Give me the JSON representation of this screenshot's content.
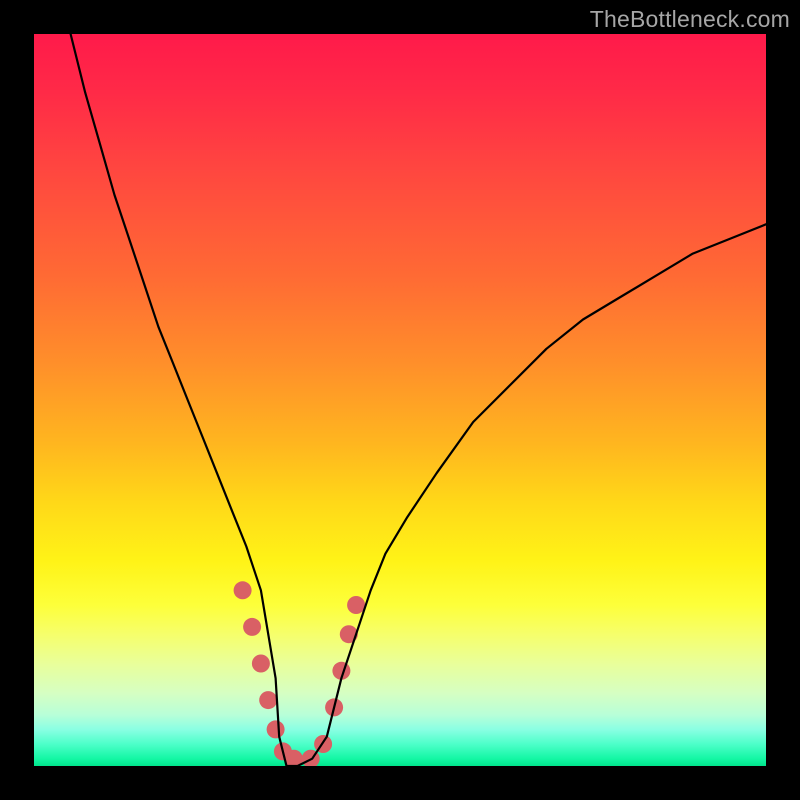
{
  "watermark": "TheBottleneck.com",
  "chart_data": {
    "type": "line",
    "title": "",
    "xlabel": "",
    "ylabel": "",
    "xlim": [
      0,
      100
    ],
    "ylim": [
      0,
      100
    ],
    "series": [
      {
        "name": "bottleneck-curve",
        "x": [
          5,
          7,
          9,
          11,
          13,
          15,
          17,
          19,
          21,
          23,
          25,
          27,
          29,
          31,
          33,
          33.5,
          34.5,
          36,
          38,
          40,
          42,
          44,
          46,
          48,
          51,
          55,
          60,
          65,
          70,
          75,
          80,
          85,
          90,
          95,
          100
        ],
        "values": [
          100,
          92,
          85,
          78,
          72,
          66,
          60,
          55,
          50,
          45,
          40,
          35,
          30,
          24,
          12,
          4,
          0,
          0,
          1,
          4,
          12,
          18,
          24,
          29,
          34,
          40,
          47,
          52,
          57,
          61,
          64,
          67,
          70,
          72,
          74
        ]
      }
    ],
    "marker_region": {
      "name": "optimal-range",
      "points": [
        {
          "x": 28.5,
          "y": 24
        },
        {
          "x": 29.8,
          "y": 19
        },
        {
          "x": 31.0,
          "y": 14
        },
        {
          "x": 32.0,
          "y": 9
        },
        {
          "x": 33.0,
          "y": 5
        },
        {
          "x": 34.0,
          "y": 2
        },
        {
          "x": 35.5,
          "y": 1
        },
        {
          "x": 37.8,
          "y": 1
        },
        {
          "x": 39.5,
          "y": 3
        },
        {
          "x": 41.0,
          "y": 8
        },
        {
          "x": 42.0,
          "y": 13
        },
        {
          "x": 43.0,
          "y": 18
        },
        {
          "x": 44.0,
          "y": 22
        }
      ],
      "color": "#d96065",
      "radius_px": 9
    },
    "gradient_stops": [
      {
        "pos": 0,
        "color": "#ff1a4a"
      },
      {
        "pos": 50,
        "color": "#ff9a28"
      },
      {
        "pos": 72,
        "color": "#fff317"
      },
      {
        "pos": 100,
        "color": "#00e58c"
      }
    ]
  }
}
